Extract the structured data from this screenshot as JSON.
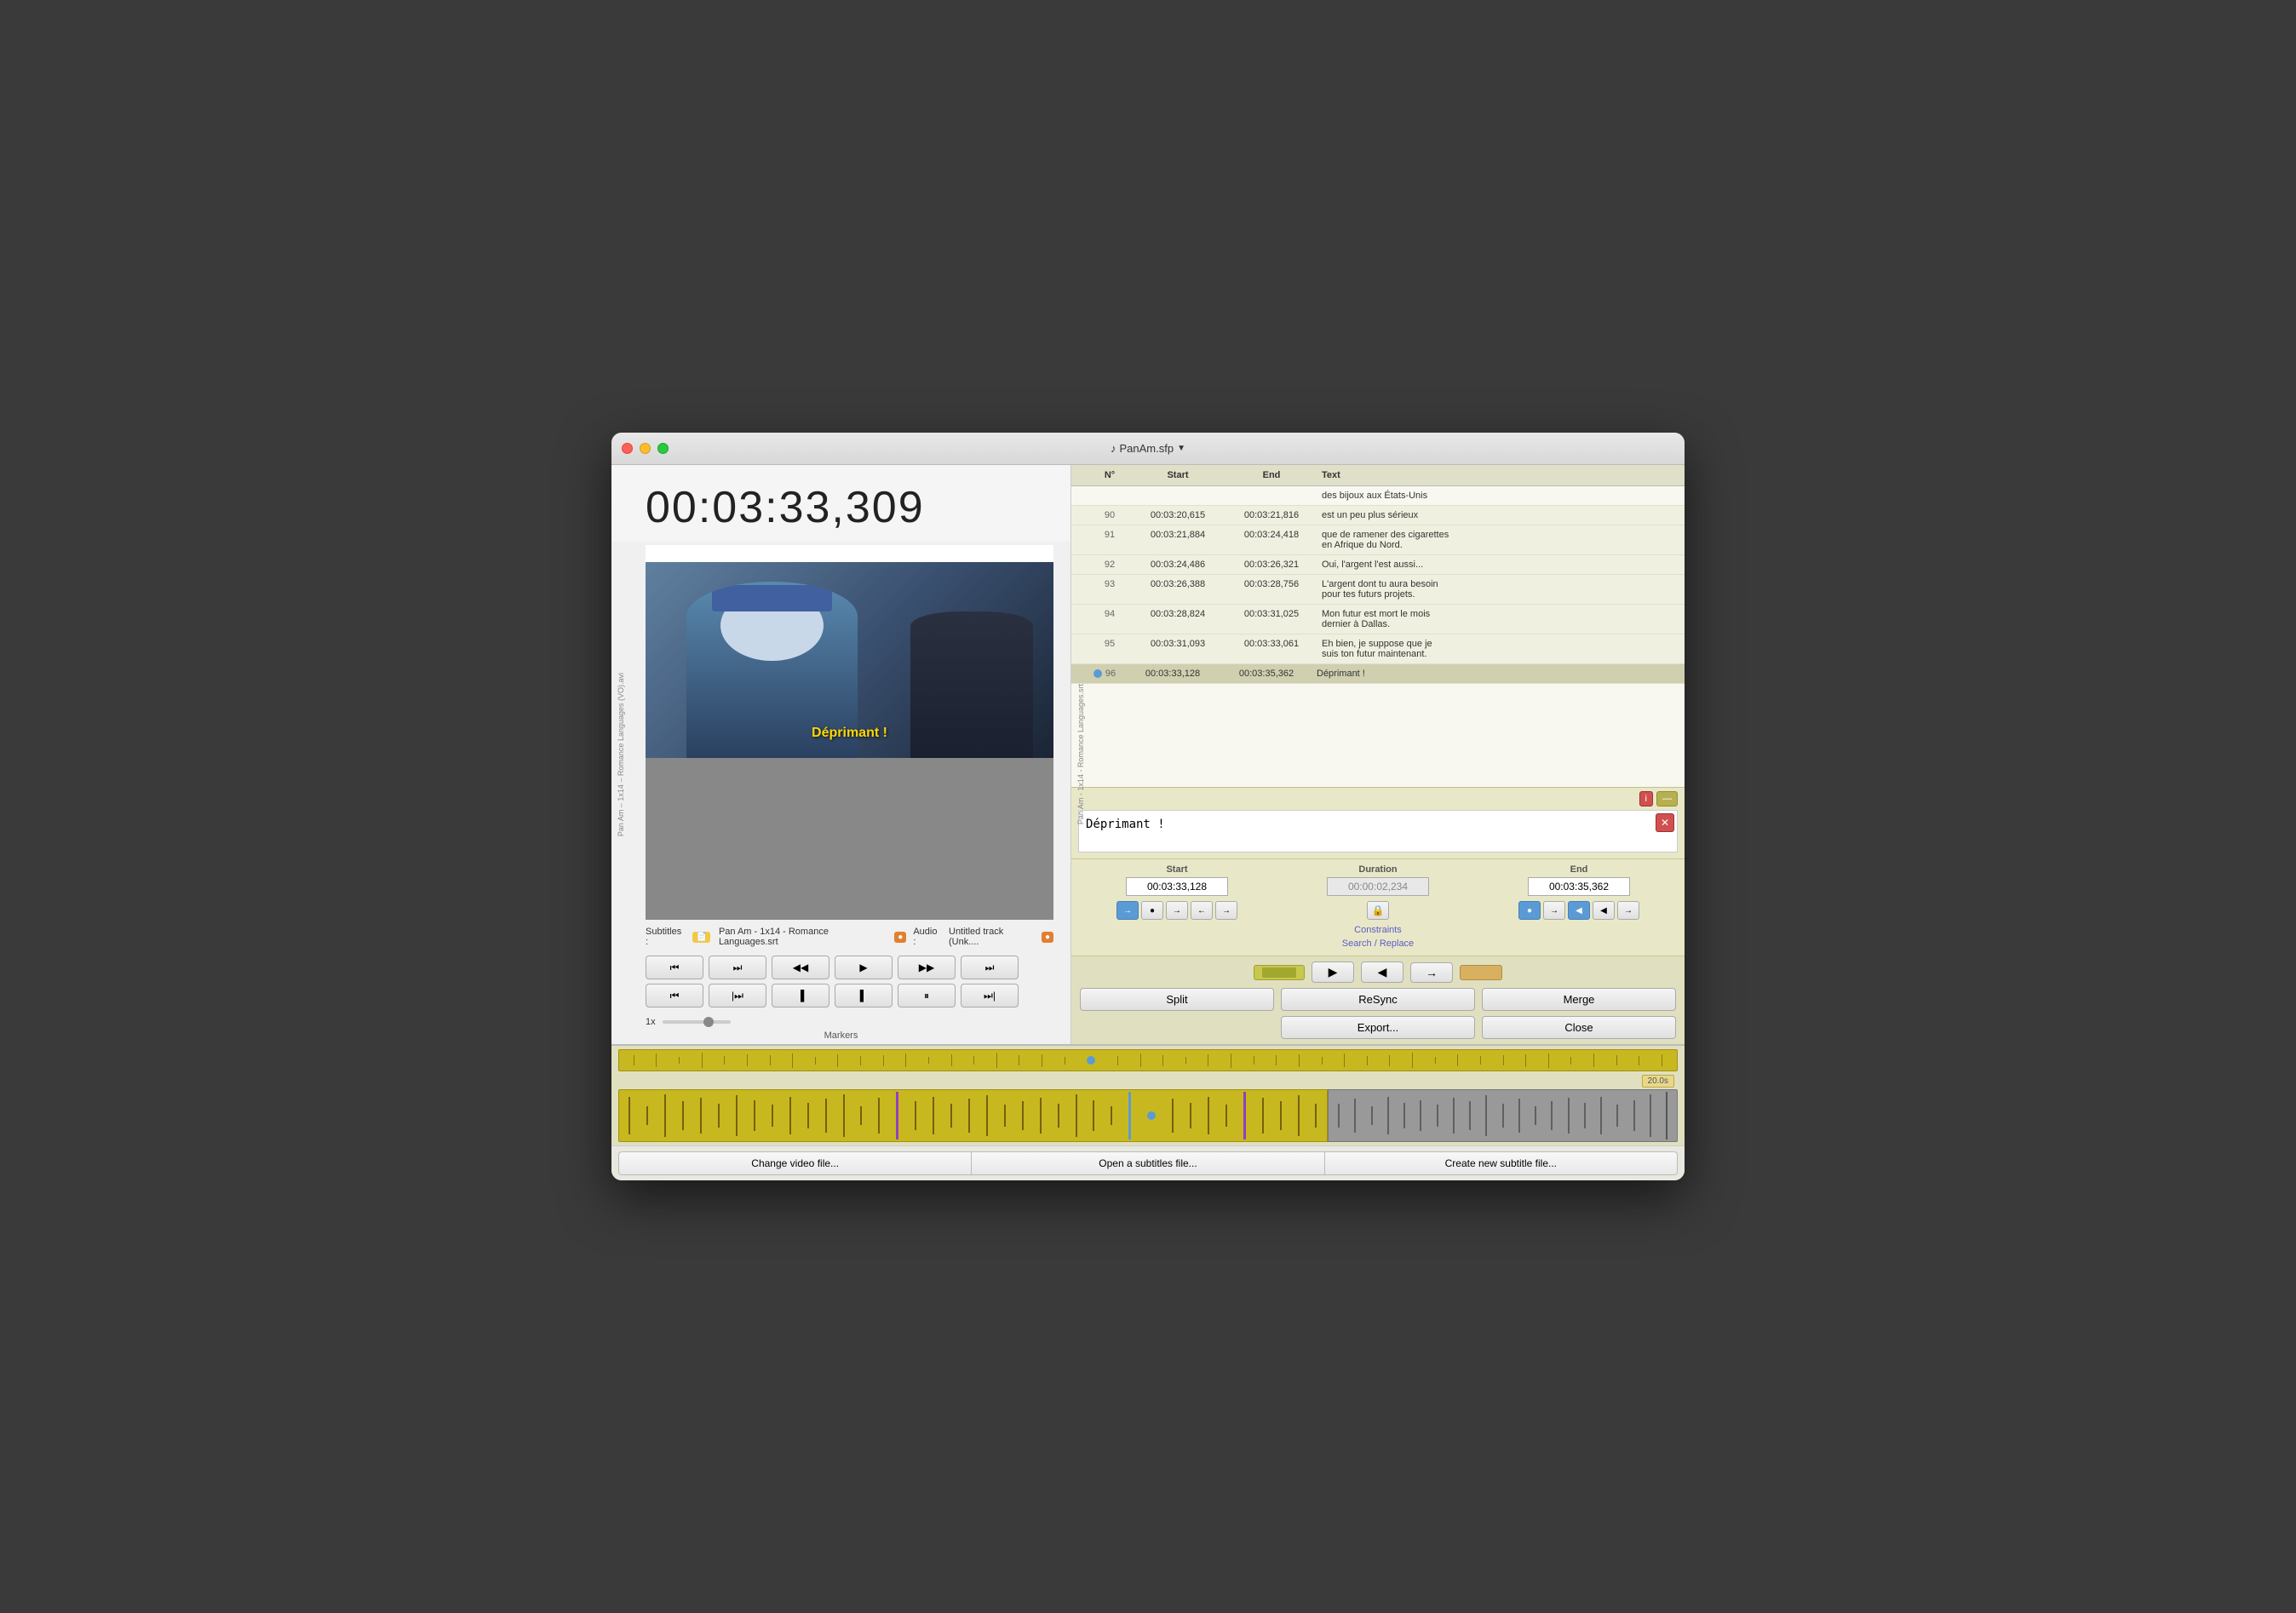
{
  "window": {
    "title": "PanAm.sfp",
    "title_icon": "♪"
  },
  "timecode": "00:03:33,309",
  "video": {
    "subtitle_overlay": "Déprimant !"
  },
  "subtitles_label": "Subtitles :",
  "subtitle_file": "Pan Am - 1x14 - Romance Languages.srt",
  "audio_label": "Audio :",
  "audio_file": "Untitled track (Unk....",
  "sidebar_left": "Pan Am – 1x14 – Romance Languages (VO).avi",
  "sidebar_right": "Pan Am - 1x14 - Romance Languages.srt",
  "table": {
    "headers": [
      "N°",
      "Start",
      "End",
      "Text"
    ],
    "rows": [
      {
        "num": "",
        "start": "",
        "end": "",
        "text": "des bijoux aux États-Unis",
        "partial": true
      },
      {
        "num": "90",
        "start": "00:03:20,615",
        "end": "00:03:21,816",
        "text": "est un peu plus sérieux"
      },
      {
        "num": "91",
        "start": "00:03:21,884",
        "end": "00:03:24,418",
        "text": "que de ramener des cigarettes\nen Afrique du Nord."
      },
      {
        "num": "92",
        "start": "00:03:24,486",
        "end": "00:03:26,321",
        "text": "Oui, l'argent l'est aussi..."
      },
      {
        "num": "93",
        "start": "00:03:26,388",
        "end": "00:03:28,756",
        "text": "L'argent dont tu aura besoin\npour tes futurs projets."
      },
      {
        "num": "94",
        "start": "00:03:28,824",
        "end": "00:03:31,025",
        "text": "Mon futur est mort le mois\ndernier à Dallas."
      },
      {
        "num": "95",
        "start": "00:03:31,093",
        "end": "00:03:33,061",
        "text": "Eh bien, je suppose que je\nsuis ton futur maintenant."
      },
      {
        "num": "96",
        "start": "00:03:33,128",
        "end": "00:03:35,362",
        "text": "Déprimant !",
        "active": true
      }
    ]
  },
  "edit": {
    "text": "Déprimant !",
    "delete_btn": "✕"
  },
  "timing": {
    "start_label": "Start",
    "start_value": "00:03:33,128",
    "duration_label": "Duration",
    "duration_value": "00:00:02,234",
    "end_label": "End",
    "end_value": "00:03:35,362"
  },
  "constraints_label": "Constraints",
  "search_replace_label": "Search / Replace",
  "actions": {
    "split": "Split",
    "resync": "ReSync",
    "merge": "Merge",
    "export": "Export...",
    "close": "Close"
  },
  "bottom_buttons": {
    "change_video": "Change video file...",
    "open_subtitles": "Open a subtitles file...",
    "create_subtitle": "Create new subtitle file..."
  },
  "speed": "1x",
  "markers": "Markers",
  "waveform_time": "20.0s",
  "transport": {
    "row1": [
      "⏮",
      "⏭",
      "◀",
      "▶",
      "▶▶",
      "⏭"
    ],
    "row2": [
      "⏮",
      "⏭",
      "▌",
      "▐",
      "⏸",
      "⏭"
    ]
  }
}
